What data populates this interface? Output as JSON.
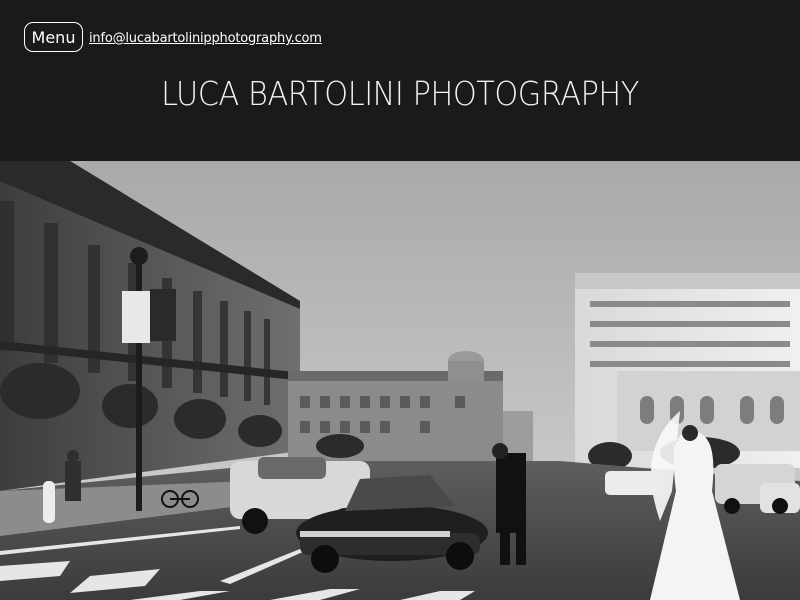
{
  "header": {
    "menu_label": "Menu",
    "email": "info@lucabartolinipphotography.com",
    "site_title": "LUCA BARTOLINI PHOTOGRAPHY"
  },
  "hero": {
    "banner_text": "LUCA BARTOLINI PHOTOGRAPHY"
  },
  "colors": {
    "background": "#1a1a1a",
    "text": "#ffffff"
  }
}
